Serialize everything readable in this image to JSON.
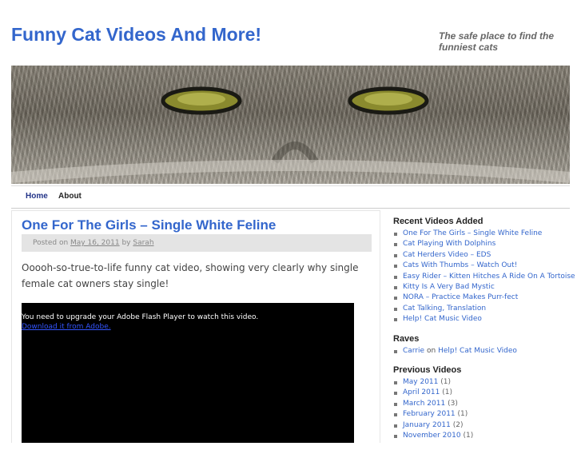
{
  "site": {
    "title": "Funny Cat Videos And More!",
    "tagline": "The safe place to find the funniest cats"
  },
  "nav": {
    "items": [
      {
        "label": "Home"
      },
      {
        "label": "About"
      }
    ]
  },
  "post": {
    "title": "One For The Girls – Single White Feline",
    "meta_prefix": "Posted on",
    "date": "May 16, 2011",
    "meta_by": "by",
    "author": "Sarah",
    "excerpt": "Ooooh-so-true-to-life funny cat video, showing very clearly why single female cat owners stay single!",
    "video_message": "You need to upgrade your Adobe Flash Player to watch this video.",
    "video_download_link": "Download it from Adobe."
  },
  "sidebar": {
    "recent": {
      "heading": "Recent Videos Added",
      "items": [
        "One For The Girls – Single White Feline",
        "Cat Playing With Dolphins",
        "Cat Herders Video – EDS",
        "Cats With Thumbs – Watch Out!",
        "Easy Rider – Kitten Hitches A Ride On A Tortoise",
        "Kitty Is A Very Bad Mystic",
        "NORA – Practice Makes Purr-fect",
        "Cat Talking, Translation",
        "Help! Cat Music Video"
      ]
    },
    "raves": {
      "heading": "Raves",
      "items": [
        {
          "author": "Carrie",
          "on": "on",
          "post": "Help! Cat Music Video"
        }
      ]
    },
    "archives": {
      "heading": "Previous Videos",
      "items": [
        {
          "month": "May 2011",
          "count": "(1)"
        },
        {
          "month": "April 2011",
          "count": "(1)"
        },
        {
          "month": "March 2011",
          "count": "(3)"
        },
        {
          "month": "February 2011",
          "count": "(1)"
        },
        {
          "month": "January 2011",
          "count": "(2)"
        },
        {
          "month": "November 2010",
          "count": "(1)"
        }
      ]
    }
  },
  "colors": {
    "link": "#3366cc",
    "meta_bg": "#e4e4e4",
    "video_bg": "#000000"
  }
}
